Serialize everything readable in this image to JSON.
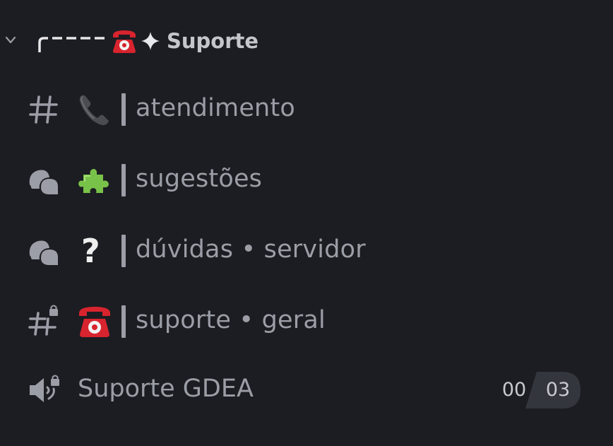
{
  "category": {
    "name": "Suporte",
    "prefix": "╭----",
    "collapsed": false
  },
  "channels": [
    {
      "type": "text",
      "icon": "hash-icon",
      "emoji": "telephone-receiver",
      "name": "atendimento"
    },
    {
      "type": "forum",
      "icon": "forum-icon",
      "emoji": "puzzle-piece",
      "name": "sugestões"
    },
    {
      "type": "forum",
      "icon": "forum-icon",
      "emoji": "question-mark",
      "name": "dúvidas • servidor"
    },
    {
      "type": "text-locked",
      "icon": "hash-lock-icon",
      "emoji": "telephone",
      "name": "suporte • geral"
    }
  ],
  "voice": {
    "name": "Suporte GDEA",
    "icon": "locked-speaker-icon",
    "users": "00",
    "limit": "03"
  },
  "colors": {
    "background": "#1c1d22",
    "text_muted": "#9b9ea6",
    "category_text": "#c4c6cc",
    "counter_bg": "#34363d",
    "phone_red": "#d8242e"
  },
  "glyphs": {
    "question": "?"
  }
}
